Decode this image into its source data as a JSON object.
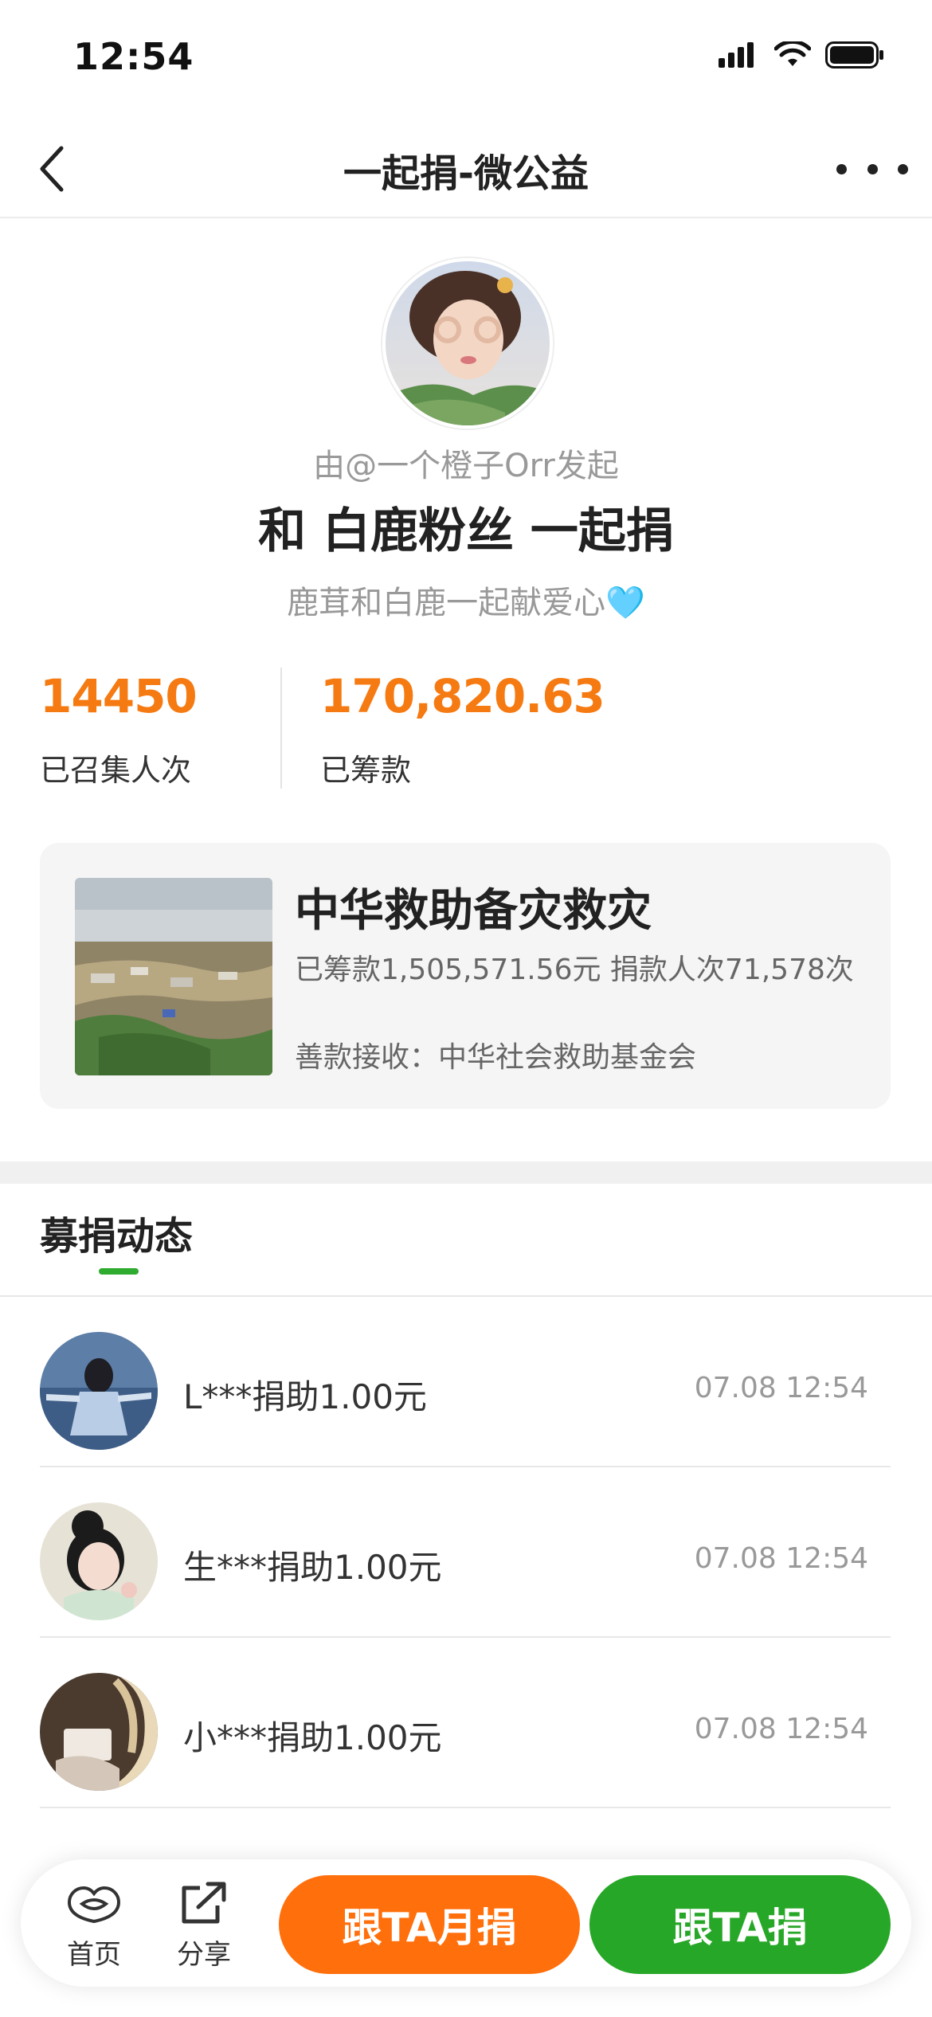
{
  "status_bar": {
    "time": "12:54"
  },
  "nav": {
    "title": "一起捐-微公益"
  },
  "profile": {
    "initiator": "由@一个橙子Orr发起",
    "title": "和 白鹿粉丝 一起捐",
    "slogan": "鹿茸和白鹿一起献爱心🩵"
  },
  "stats": {
    "participants": {
      "value": "14450",
      "label": "已召集人次"
    },
    "raised": {
      "value": "170,820.63",
      "label": "已筹款"
    }
  },
  "project": {
    "name": "中华救助备灾救灾",
    "stats": "已筹款1,505,571.56元  捐款人次71,578次",
    "receiver": "善款接收：中华社会救助基金会"
  },
  "tabs": {
    "active": "募捐动态"
  },
  "donations": [
    {
      "text": "L***捐助1.00元",
      "time": "07.08 12:54"
    },
    {
      "text": "生***捐助1.00元",
      "time": "07.08 12:54"
    },
    {
      "text": "小***捐助1.00元",
      "time": "07.08 12:54"
    }
  ],
  "bottom_bar": {
    "home_label": "首页",
    "share_label": "分享",
    "monthly_button": "跟TA月捐",
    "donate_button": "跟TA捐"
  },
  "colors": {
    "accent_orange": "#f57a12",
    "button_orange": "#ff6f0c",
    "button_green": "#27a727",
    "tab_green": "#2fab2f"
  }
}
